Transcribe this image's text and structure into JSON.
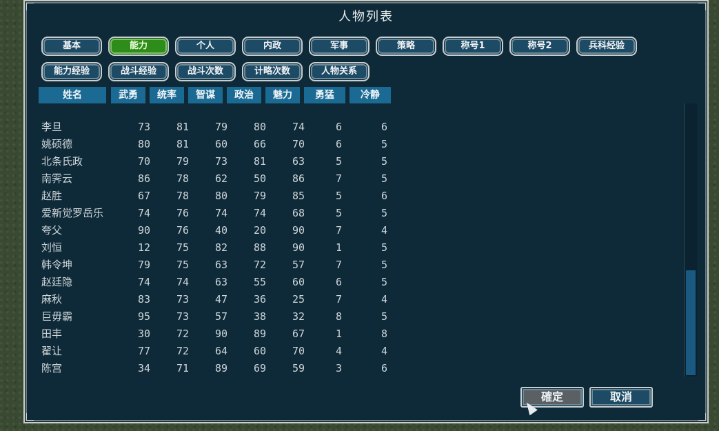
{
  "window": {
    "title": "人物列表"
  },
  "tabs": [
    {
      "label": "基本",
      "active": false
    },
    {
      "label": "能力",
      "active": true
    },
    {
      "label": "个人",
      "active": false
    },
    {
      "label": "内政",
      "active": false
    },
    {
      "label": "军事",
      "active": false
    },
    {
      "label": "策略",
      "active": false
    },
    {
      "label": "称号1",
      "active": false
    },
    {
      "label": "称号2",
      "active": false
    },
    {
      "label": "兵科经验",
      "active": false
    },
    {
      "label": "能力经验",
      "active": false
    },
    {
      "label": "战斗经验",
      "active": false
    },
    {
      "label": "战斗次数",
      "active": false
    },
    {
      "label": "计略次数",
      "active": false
    },
    {
      "label": "人物关系",
      "active": false
    }
  ],
  "columns": [
    "姓名",
    "武勇",
    "统率",
    "智谋",
    "政治",
    "魅力",
    "勇猛",
    "冷静"
  ],
  "rows": [
    {
      "name": "李旦",
      "values": [
        "73",
        "81",
        "79",
        "80",
        "74",
        "6",
        "6"
      ]
    },
    {
      "name": "姚硕德",
      "values": [
        "80",
        "81",
        "60",
        "66",
        "70",
        "6",
        "5"
      ]
    },
    {
      "name": "北条氏政",
      "values": [
        "70",
        "79",
        "73",
        "81",
        "63",
        "5",
        "5"
      ]
    },
    {
      "name": "南霁云",
      "values": [
        "86",
        "78",
        "62",
        "50",
        "86",
        "7",
        "5"
      ]
    },
    {
      "name": "赵胜",
      "values": [
        "67",
        "78",
        "80",
        "79",
        "85",
        "5",
        "6"
      ]
    },
    {
      "name": "爱新觉罗岳乐",
      "values": [
        "74",
        "76",
        "74",
        "74",
        "68",
        "5",
        "5"
      ]
    },
    {
      "name": "夸父",
      "values": [
        "90",
        "76",
        "40",
        "20",
        "90",
        "7",
        "4"
      ]
    },
    {
      "name": "刘恒",
      "values": [
        "12",
        "75",
        "82",
        "88",
        "90",
        "1",
        "5"
      ]
    },
    {
      "name": "韩令坤",
      "values": [
        "79",
        "75",
        "63",
        "72",
        "57",
        "7",
        "5"
      ]
    },
    {
      "name": "赵廷隐",
      "values": [
        "74",
        "74",
        "63",
        "55",
        "60",
        "6",
        "5"
      ]
    },
    {
      "name": "麻秋",
      "values": [
        "83",
        "73",
        "47",
        "36",
        "25",
        "7",
        "4"
      ]
    },
    {
      "name": "巨毋霸",
      "values": [
        "95",
        "73",
        "57",
        "38",
        "32",
        "8",
        "5"
      ]
    },
    {
      "name": "田丰",
      "values": [
        "30",
        "72",
        "90",
        "89",
        "67",
        "1",
        "8"
      ]
    },
    {
      "name": "翟让",
      "values": [
        "77",
        "72",
        "64",
        "60",
        "70",
        "4",
        "4"
      ]
    },
    {
      "name": "陈宫",
      "values": [
        "34",
        "71",
        "89",
        "69",
        "59",
        "3",
        "6"
      ]
    }
  ],
  "buttons": {
    "ok": "確定",
    "cancel": "取消"
  },
  "colors": {
    "panel": "#0e2a38",
    "header": "#1b6a94",
    "active_tab": "#2e8c1a",
    "tab": "#1d4a64"
  }
}
